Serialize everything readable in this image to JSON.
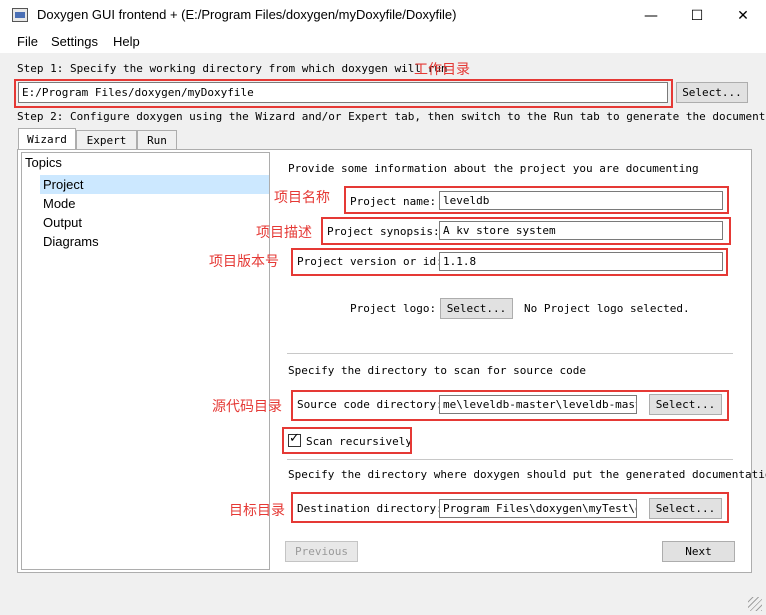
{
  "window": {
    "title": "Doxygen GUI frontend + (E:/Program Files/doxygen/myDoxyfile/Doxyfile)",
    "minimize_glyph": "—",
    "maximize_glyph": "☐",
    "close_glyph": "✕"
  },
  "menu": {
    "file": "File",
    "settings": "Settings",
    "help": "Help"
  },
  "step1": {
    "label": "Step 1: Specify the working directory from which doxygen will run",
    "annotation": "工作目录",
    "value": "E:/Program Files/doxygen/myDoxyfile",
    "select": "Select..."
  },
  "step2": {
    "label": "Step 2: Configure doxygen using the Wizard and/or Expert tab, then switch to the Run tab to generate the documentation"
  },
  "tabs": {
    "wizard": "Wizard",
    "expert": "Expert",
    "run": "Run"
  },
  "topics": {
    "header": "Topics",
    "items": [
      "Project",
      "Mode",
      "Output",
      "Diagrams"
    ],
    "selected": "Project"
  },
  "project": {
    "intro": "Provide some information about the project you are documenting",
    "name_label": "Project name:",
    "name_value": "leveldb",
    "name_annotation": "项目名称",
    "synopsis_label": "Project synopsis:",
    "synopsis_value": "A kv store system",
    "synopsis_annotation": "项目描述",
    "version_label": "Project version or id:",
    "version_value": "1.1.8",
    "version_annotation": "项目版本号",
    "logo_label": "Project logo:",
    "logo_select": "Select...",
    "logo_status": "No Project logo selected."
  },
  "source": {
    "intro": "Specify the directory to scan for source code",
    "label": "Source code directory:",
    "value": "me\\leveldb-master\\leveldb-master",
    "select": "Select...",
    "annotation": "源代码目录",
    "scan_label": "Scan recursively",
    "scan_checked": true,
    "check_glyph": "✓"
  },
  "destination": {
    "intro": "Specify the directory where doxygen should put the generated documentation",
    "label": "Destination directory:",
    "value": "Program Files\\doxygen\\myTest\\doc",
    "select": "Select...",
    "annotation": "目标目录"
  },
  "nav": {
    "previous": "Previous",
    "next": "Next"
  },
  "colors": {
    "annotation": "#e53935",
    "selection": "#cce8ff"
  }
}
